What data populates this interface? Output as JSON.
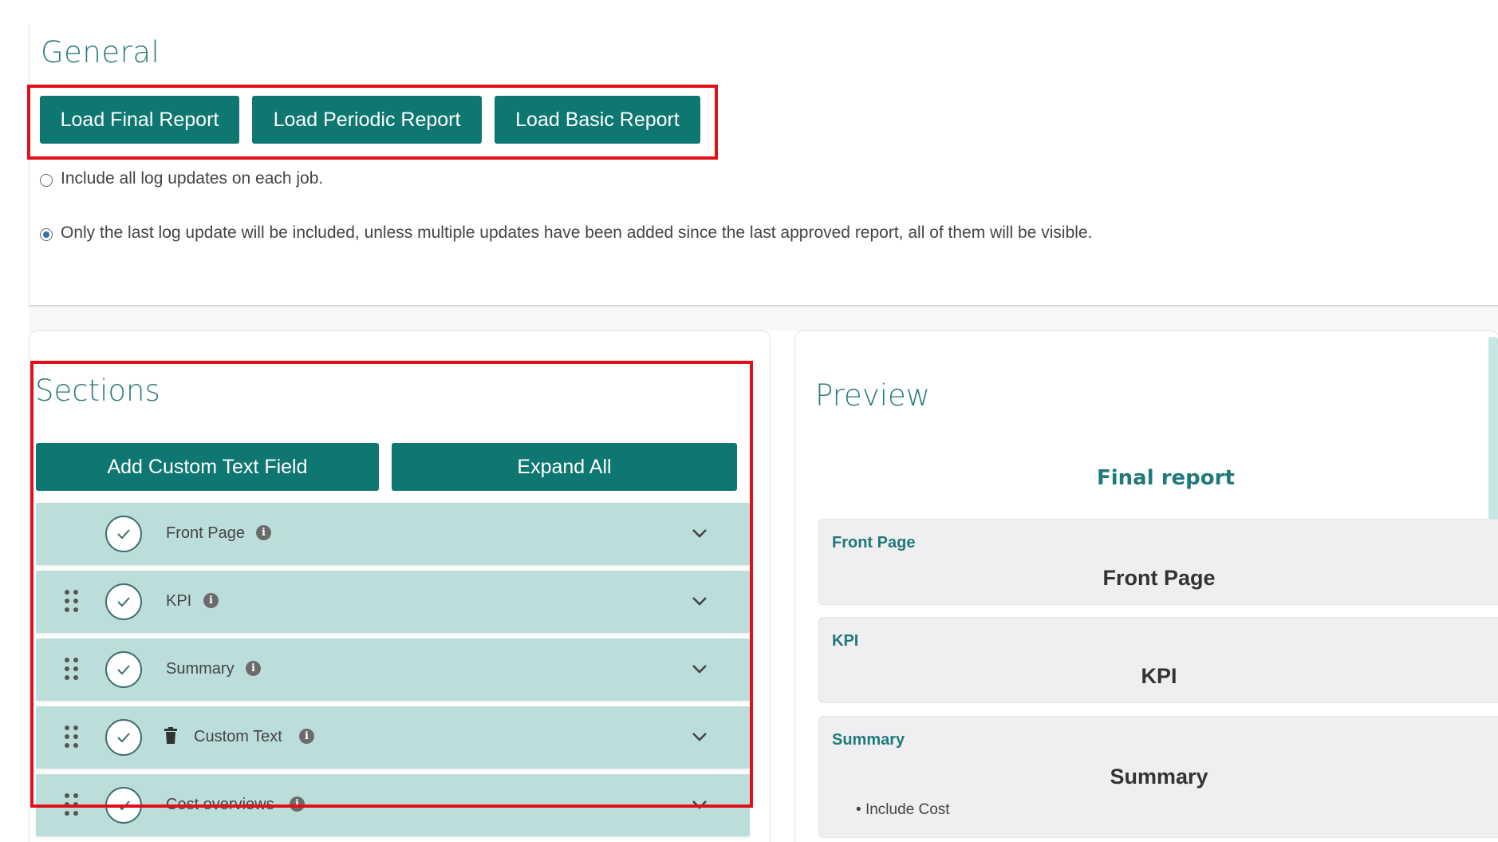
{
  "general": {
    "title": "General",
    "buttons": {
      "load_final": "Load Final Report",
      "load_periodic": "Load Periodic Report",
      "load_basic": "Load Basic Report"
    },
    "options": [
      {
        "label": "Include all log updates on each job.",
        "checked": false
      },
      {
        "label": "Only the last log update will be included, unless multiple updates have been added since the last approved report, all of them will be visible.",
        "checked": true
      }
    ]
  },
  "sections": {
    "title": "Sections",
    "add_button": "Add Custom Text Field",
    "expand_button": "Expand All",
    "items": [
      {
        "label": "Front Page",
        "draggable": false,
        "deletable": false,
        "checked": true
      },
      {
        "label": "KPI",
        "draggable": true,
        "deletable": false,
        "checked": true
      },
      {
        "label": "Summary",
        "draggable": true,
        "deletable": false,
        "checked": true
      },
      {
        "label": "Custom Text",
        "draggable": true,
        "deletable": true,
        "checked": true
      },
      {
        "label": "Cost overviews",
        "draggable": true,
        "deletable": false,
        "checked": true
      }
    ]
  },
  "preview": {
    "title": "Preview",
    "report_title": "Final report",
    "cards": [
      {
        "label": "Front Page",
        "title": "Front Page"
      },
      {
        "label": "KPI",
        "title": "KPI"
      },
      {
        "label": "Summary",
        "title": "Summary",
        "bullets": [
          "Include Cost"
        ]
      }
    ]
  },
  "colors": {
    "accent": "#0e7772",
    "heading": "#2b7c7b",
    "section_row": "#bcdedb",
    "highlight_border": "#e0101b"
  }
}
